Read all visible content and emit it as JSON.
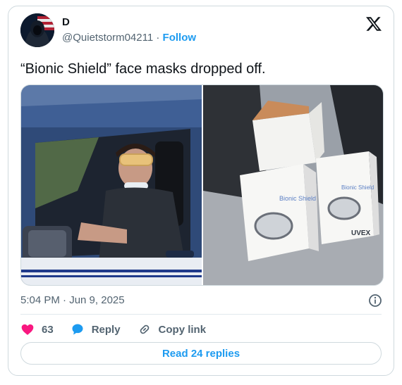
{
  "author": {
    "name": "D",
    "handle": "@Quietstorm04211",
    "separator": " · ",
    "follow_label": "Follow"
  },
  "tweet": {
    "text": "“Bionic Shield” face masks dropped off.",
    "timestamp": "5:04 PM · Jun 9, 2025"
  },
  "media": {
    "box_brand": "Bionic Shield",
    "box_maker": "UVEX"
  },
  "actions": {
    "like_count": "63",
    "reply_label": "Reply",
    "copy_link_label": "Copy link",
    "read_replies_label": "Read 24 replies"
  },
  "colors": {
    "accent": "#1d9bf0",
    "like": "#f91880",
    "muted_text": "#536471"
  },
  "icons": [
    "x-logo-icon",
    "info-icon",
    "heart-icon",
    "reply-bubble-icon",
    "link-icon"
  ]
}
